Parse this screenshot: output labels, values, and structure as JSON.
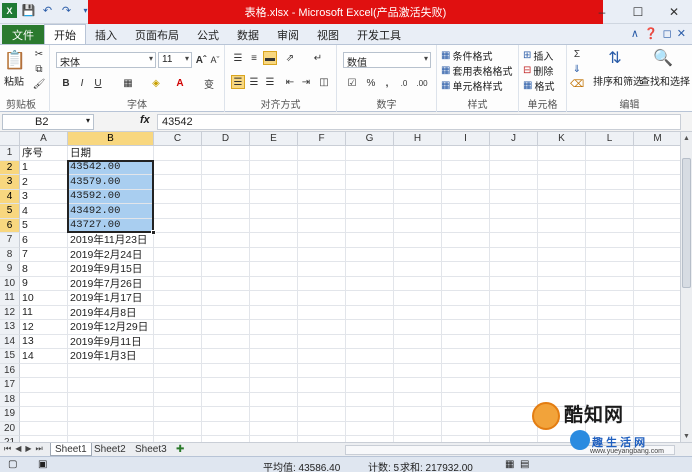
{
  "window": {
    "title": "表格.xlsx  -  Microsoft Excel(产品激活失败)",
    "controls": [
      "–",
      "☐",
      "✕"
    ]
  },
  "ribbon_tabs": [
    {
      "label": "文件",
      "kind": "file"
    },
    {
      "label": "开始",
      "kind": "active"
    },
    {
      "label": "插入"
    },
    {
      "label": "页面布局"
    },
    {
      "label": "公式"
    },
    {
      "label": "数据"
    },
    {
      "label": "审阅"
    },
    {
      "label": "视图"
    },
    {
      "label": "开发工具"
    }
  ],
  "ribbon": {
    "clipboard": {
      "paste": "粘贴",
      "label": "剪贴板"
    },
    "font": {
      "name": "宋体",
      "size": "11",
      "bold": "B",
      "italic": "I",
      "underline": "U",
      "label": "字体"
    },
    "alignment": {
      "label": "对齐方式"
    },
    "number": {
      "format": "数值",
      "label": "数字"
    },
    "styles": {
      "conditional": "条件格式",
      "table": "套用表格格式",
      "cell": "单元格样式",
      "label": "样式"
    },
    "cells": {
      "insert": "插入",
      "delete": "删除",
      "format": "格式",
      "label": "单元格"
    },
    "editing": {
      "sort": "排序和筛选",
      "find": "查找和选择",
      "label": "编辑"
    }
  },
  "formula_bar": {
    "name_box": "B2",
    "fx": "fx",
    "value": "43542"
  },
  "columns": [
    "A",
    "B",
    "C",
    "D",
    "E",
    "F",
    "G",
    "H",
    "I",
    "J",
    "K",
    "L",
    "M"
  ],
  "selected_column": "B",
  "rows": [
    {
      "n": "1",
      "a": "序号",
      "b": "日期"
    },
    {
      "n": "2",
      "a": "1",
      "b": "43542.00"
    },
    {
      "n": "3",
      "a": "2",
      "b": "43579.00"
    },
    {
      "n": "4",
      "a": "3",
      "b": "43592.00"
    },
    {
      "n": "5",
      "a": "4",
      "b": "43492.00"
    },
    {
      "n": "6",
      "a": "5",
      "b": "43727.00"
    },
    {
      "n": "7",
      "a": "6",
      "b": "2019年11月23日"
    },
    {
      "n": "8",
      "a": "7",
      "b": "2019年2月24日"
    },
    {
      "n": "9",
      "a": "8",
      "b": "2019年9月15日"
    },
    {
      "n": "10",
      "a": "9",
      "b": "2019年7月26日"
    },
    {
      "n": "11",
      "a": "10",
      "b": "2019年1月17日"
    },
    {
      "n": "12",
      "a": "11",
      "b": "2019年4月8日"
    },
    {
      "n": "13",
      "a": "12",
      "b": "2019年12月29日"
    },
    {
      "n": "14",
      "a": "13",
      "b": "2019年9月11日"
    },
    {
      "n": "15",
      "a": "14",
      "b": "2019年1月3日"
    },
    {
      "n": "16",
      "a": "",
      "b": ""
    },
    {
      "n": "17",
      "a": "",
      "b": ""
    },
    {
      "n": "18",
      "a": "",
      "b": ""
    },
    {
      "n": "19",
      "a": "",
      "b": ""
    },
    {
      "n": "20",
      "a": "",
      "b": ""
    },
    {
      "n": "21",
      "a": "",
      "b": ""
    }
  ],
  "selected_rows": [
    "2",
    "3",
    "4",
    "5",
    "6"
  ],
  "sheet_tabs": [
    "Sheet1",
    "Sheet2",
    "Sheet3"
  ],
  "active_sheet": "Sheet1",
  "status": {
    "average": "平均值: 43586.40",
    "count": "计数: 5",
    "sum": "求和: 217932.00"
  },
  "watermark": {
    "line1": "酷知网",
    "line2": "趣 生 活 网",
    "line3": "www.yueyangbang.com"
  }
}
